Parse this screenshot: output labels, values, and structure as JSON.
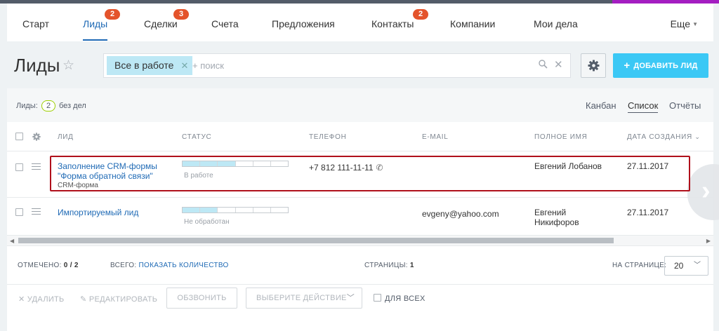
{
  "nav": {
    "items": [
      {
        "label": "Старт"
      },
      {
        "label": "Лиды",
        "badge": "2",
        "active": true
      },
      {
        "label": "Сделки",
        "badge": "3"
      },
      {
        "label": "Счета"
      },
      {
        "label": "Предложения"
      },
      {
        "label": "Контакты",
        "badge": "2"
      },
      {
        "label": "Компании"
      },
      {
        "label": "Мои дела"
      }
    ],
    "more_label": "Еще"
  },
  "header": {
    "title": "Лиды",
    "filter_tag": "Все в работе",
    "search_placeholder": "+ поиск",
    "add_button": "ДОБАВИТЬ ЛИД"
  },
  "counter": {
    "label": "Лиды:",
    "count": "2",
    "text": "без дел"
  },
  "views": {
    "kanban": "Канбан",
    "list": "Список",
    "reports": "Отчёты"
  },
  "table": {
    "columns": {
      "lead": "ЛИД",
      "status": "СТАТУС",
      "phone": "ТЕЛЕФОН",
      "email": "E-MAIL",
      "fullname": "ПОЛНОЕ ИМЯ",
      "created": "ДАТА СОЗДАНИЯ"
    },
    "rows": [
      {
        "lead_line1": "Заполнение CRM-формы",
        "lead_line2": "\"Форма обратной связи\"",
        "source": "CRM-форма",
        "status": "В работе",
        "status_progress": 0.5,
        "phone": "+7 812 111-11-11",
        "email": "",
        "fullname_line1": "Евгений Лобанов",
        "fullname_line2": "",
        "created": "27.11.2017"
      },
      {
        "lead_line1": "Импортируемый лид",
        "lead_line2": "",
        "source": "",
        "status": "Не обработан",
        "status_progress": 0.25,
        "phone": "",
        "email": "evgeny@yahoo.com",
        "fullname_line1": "Евгений",
        "fullname_line2": "Никифоров",
        "created": "27.11.2017"
      }
    ]
  },
  "footer": {
    "checked_label": "ОТМЕЧЕНО:",
    "checked_value": "0 / 2",
    "total_label": "ВСЕГО:",
    "total_link": "ПОКАЗАТЬ КОЛИЧЕСТВО",
    "pages_label": "СТРАНИЦЫ:",
    "pages_value": "1",
    "per_page_label": "НА СТРАНИЦЕ:",
    "per_page_value": "20"
  },
  "actions": {
    "delete": "УДАЛИТЬ",
    "edit": "РЕДАКТИРОВАТЬ",
    "call": "ОБЗВОНИТЬ",
    "choose_action": "ВЫБЕРИТЕ ДЕЙСТВИЕ",
    "for_all": "ДЛЯ ВСЕХ"
  },
  "colors": {
    "accent": "#3bc8f5",
    "link": "#1f6ab5",
    "badge": "#e4532b",
    "highlight": "#b0101b"
  }
}
